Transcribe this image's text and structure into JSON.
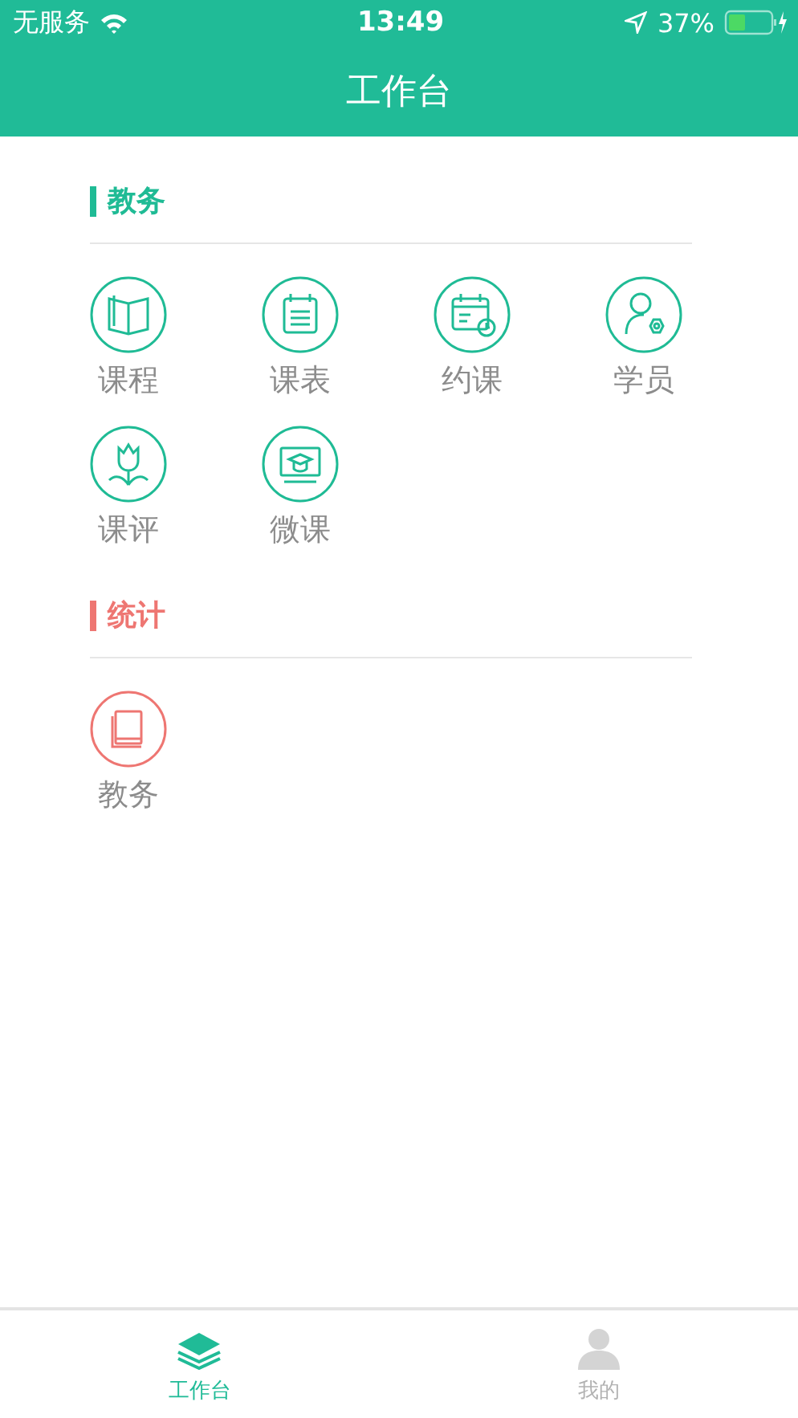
{
  "status_bar": {
    "carrier": "无服务",
    "time": "13:49",
    "battery": "37%"
  },
  "header": {
    "title": "工作台"
  },
  "sections": [
    {
      "title": "教务",
      "color": "#1fbb95",
      "items": [
        {
          "label": "课程",
          "kind": "book"
        },
        {
          "label": "课表",
          "kind": "list"
        },
        {
          "label": "约课",
          "kind": "calendar"
        },
        {
          "label": "学员",
          "kind": "person"
        },
        {
          "label": "课评",
          "kind": "flower"
        },
        {
          "label": "微课",
          "kind": "screen"
        }
      ]
    },
    {
      "title": "统计",
      "color": "#ee7672",
      "items": [
        {
          "label": "教务",
          "kind": "books"
        }
      ]
    }
  ],
  "tabs": [
    {
      "label": "工作台",
      "selected": true,
      "kind": "layers"
    },
    {
      "label": "我的",
      "selected": false,
      "kind": "person"
    }
  ]
}
